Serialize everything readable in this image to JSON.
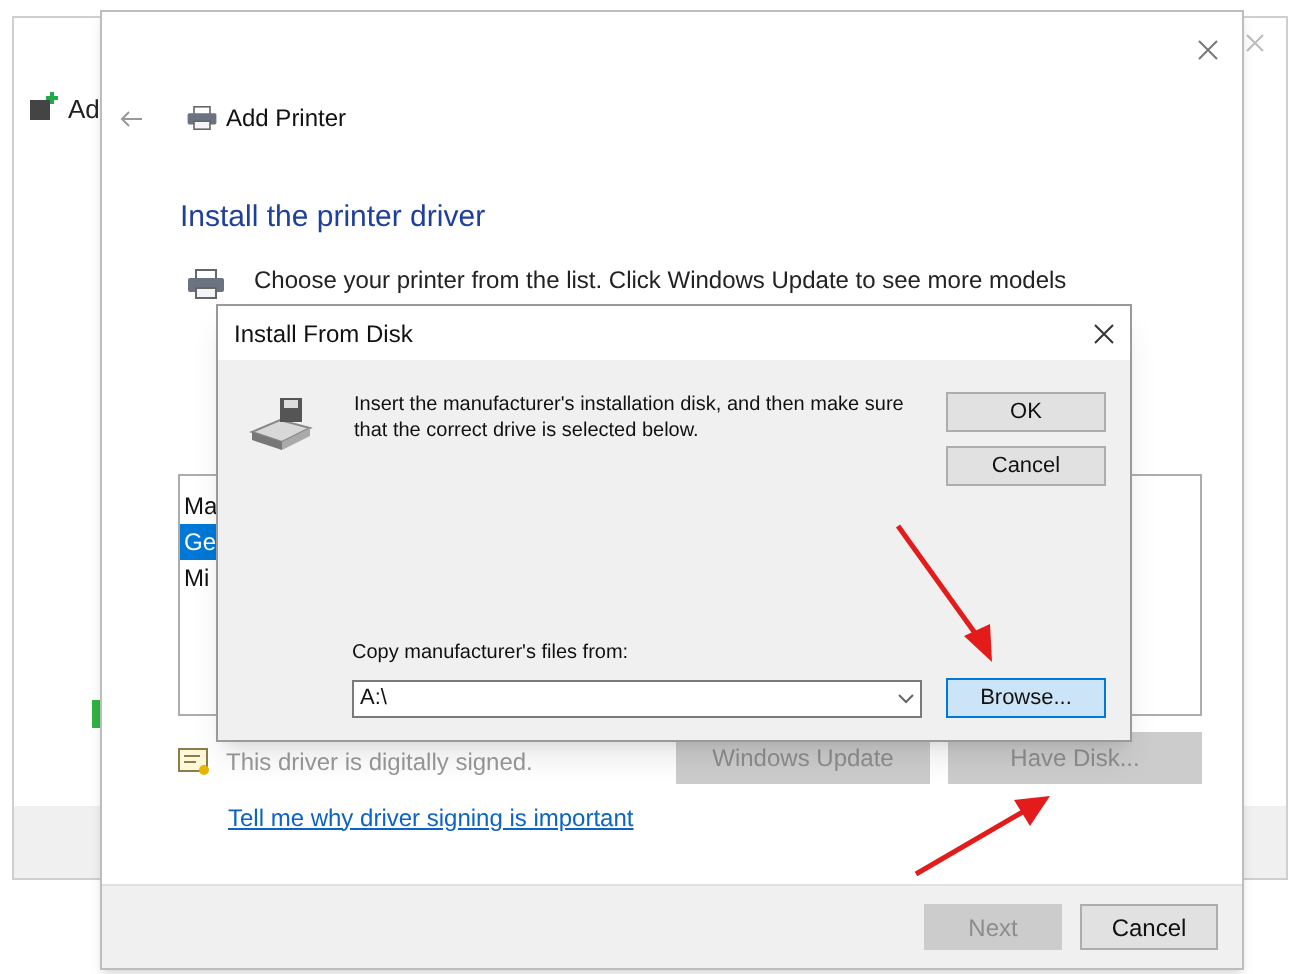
{
  "background_window": {
    "title": "Ad"
  },
  "window": {
    "title": "Add Printer",
    "heading": "Install the printer driver",
    "description": "Choose your printer from the list. Click Windows Update to see more models",
    "list_items": [
      {
        "label": "Ma",
        "selected": false
      },
      {
        "label": "Ge",
        "selected": true
      },
      {
        "label": "Mi",
        "selected": false
      }
    ],
    "signature": "This driver is digitally signed.",
    "signature_link": "Tell me why driver signing is important",
    "list_buttons": [
      {
        "label": "Windows Update",
        "disabled": true
      },
      {
        "label": "Have Disk...",
        "disabled": true
      }
    ],
    "footer_buttons": [
      {
        "label": "Next",
        "disabled": true
      },
      {
        "label": "Cancel",
        "disabled": false
      }
    ]
  },
  "dialog": {
    "title": "Install From Disk",
    "message": "Insert the manufacturer's installation disk, and then make sure that the correct drive is selected below.",
    "buttons": [
      {
        "label": "OK",
        "focused": false
      },
      {
        "label": "Cancel",
        "focused": false
      }
    ],
    "path_label": "Copy manufacturer's files from:",
    "path_value": "A:\\",
    "browse_button": {
      "label": "Browse...",
      "focused": true
    }
  }
}
